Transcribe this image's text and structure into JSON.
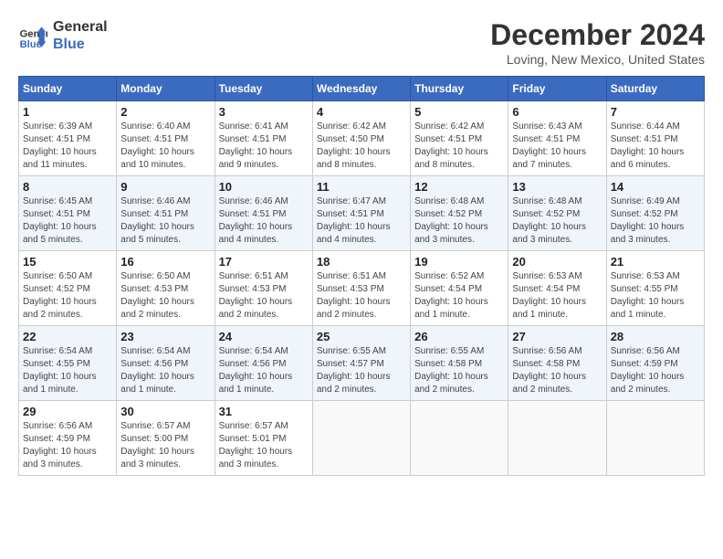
{
  "header": {
    "logo_line1": "General",
    "logo_line2": "Blue",
    "month": "December 2024",
    "location": "Loving, New Mexico, United States"
  },
  "weekdays": [
    "Sunday",
    "Monday",
    "Tuesday",
    "Wednesday",
    "Thursday",
    "Friday",
    "Saturday"
  ],
  "weeks": [
    [
      {
        "day": "1",
        "sunrise": "6:39 AM",
        "sunset": "4:51 PM",
        "daylight": "10 hours and 11 minutes."
      },
      {
        "day": "2",
        "sunrise": "6:40 AM",
        "sunset": "4:51 PM",
        "daylight": "10 hours and 10 minutes."
      },
      {
        "day": "3",
        "sunrise": "6:41 AM",
        "sunset": "4:51 PM",
        "daylight": "10 hours and 9 minutes."
      },
      {
        "day": "4",
        "sunrise": "6:42 AM",
        "sunset": "4:50 PM",
        "daylight": "10 hours and 8 minutes."
      },
      {
        "day": "5",
        "sunrise": "6:42 AM",
        "sunset": "4:51 PM",
        "daylight": "10 hours and 8 minutes."
      },
      {
        "day": "6",
        "sunrise": "6:43 AM",
        "sunset": "4:51 PM",
        "daylight": "10 hours and 7 minutes."
      },
      {
        "day": "7",
        "sunrise": "6:44 AM",
        "sunset": "4:51 PM",
        "daylight": "10 hours and 6 minutes."
      }
    ],
    [
      {
        "day": "8",
        "sunrise": "6:45 AM",
        "sunset": "4:51 PM",
        "daylight": "10 hours and 5 minutes."
      },
      {
        "day": "9",
        "sunrise": "6:46 AM",
        "sunset": "4:51 PM",
        "daylight": "10 hours and 5 minutes."
      },
      {
        "day": "10",
        "sunrise": "6:46 AM",
        "sunset": "4:51 PM",
        "daylight": "10 hours and 4 minutes."
      },
      {
        "day": "11",
        "sunrise": "6:47 AM",
        "sunset": "4:51 PM",
        "daylight": "10 hours and 4 minutes."
      },
      {
        "day": "12",
        "sunrise": "6:48 AM",
        "sunset": "4:52 PM",
        "daylight": "10 hours and 3 minutes."
      },
      {
        "day": "13",
        "sunrise": "6:48 AM",
        "sunset": "4:52 PM",
        "daylight": "10 hours and 3 minutes."
      },
      {
        "day": "14",
        "sunrise": "6:49 AM",
        "sunset": "4:52 PM",
        "daylight": "10 hours and 3 minutes."
      }
    ],
    [
      {
        "day": "15",
        "sunrise": "6:50 AM",
        "sunset": "4:52 PM",
        "daylight": "10 hours and 2 minutes."
      },
      {
        "day": "16",
        "sunrise": "6:50 AM",
        "sunset": "4:53 PM",
        "daylight": "10 hours and 2 minutes."
      },
      {
        "day": "17",
        "sunrise": "6:51 AM",
        "sunset": "4:53 PM",
        "daylight": "10 hours and 2 minutes."
      },
      {
        "day": "18",
        "sunrise": "6:51 AM",
        "sunset": "4:53 PM",
        "daylight": "10 hours and 2 minutes."
      },
      {
        "day": "19",
        "sunrise": "6:52 AM",
        "sunset": "4:54 PM",
        "daylight": "10 hours and 1 minute."
      },
      {
        "day": "20",
        "sunrise": "6:53 AM",
        "sunset": "4:54 PM",
        "daylight": "10 hours and 1 minute."
      },
      {
        "day": "21",
        "sunrise": "6:53 AM",
        "sunset": "4:55 PM",
        "daylight": "10 hours and 1 minute."
      }
    ],
    [
      {
        "day": "22",
        "sunrise": "6:54 AM",
        "sunset": "4:55 PM",
        "daylight": "10 hours and 1 minute."
      },
      {
        "day": "23",
        "sunrise": "6:54 AM",
        "sunset": "4:56 PM",
        "daylight": "10 hours and 1 minute."
      },
      {
        "day": "24",
        "sunrise": "6:54 AM",
        "sunset": "4:56 PM",
        "daylight": "10 hours and 1 minute."
      },
      {
        "day": "25",
        "sunrise": "6:55 AM",
        "sunset": "4:57 PM",
        "daylight": "10 hours and 2 minutes."
      },
      {
        "day": "26",
        "sunrise": "6:55 AM",
        "sunset": "4:58 PM",
        "daylight": "10 hours and 2 minutes."
      },
      {
        "day": "27",
        "sunrise": "6:56 AM",
        "sunset": "4:58 PM",
        "daylight": "10 hours and 2 minutes."
      },
      {
        "day": "28",
        "sunrise": "6:56 AM",
        "sunset": "4:59 PM",
        "daylight": "10 hours and 2 minutes."
      }
    ],
    [
      {
        "day": "29",
        "sunrise": "6:56 AM",
        "sunset": "4:59 PM",
        "daylight": "10 hours and 3 minutes."
      },
      {
        "day": "30",
        "sunrise": "6:57 AM",
        "sunset": "5:00 PM",
        "daylight": "10 hours and 3 minutes."
      },
      {
        "day": "31",
        "sunrise": "6:57 AM",
        "sunset": "5:01 PM",
        "daylight": "10 hours and 3 minutes."
      },
      null,
      null,
      null,
      null
    ]
  ],
  "labels": {
    "sunrise": "Sunrise:",
    "sunset": "Sunset:",
    "daylight": "Daylight:"
  }
}
